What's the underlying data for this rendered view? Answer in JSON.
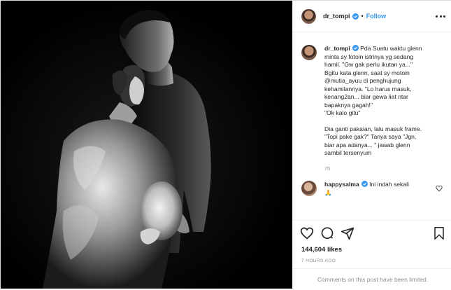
{
  "post": {
    "author": "dr_tompi",
    "follow_label": "Follow",
    "separator": "•",
    "photo_alt": "Black-and-white portrait of a pregnant woman in a tulle gown and a man in a turtleneck, both facing right",
    "caption_lines": [
      "Pda Suatu waktu glenn",
      "minta sy fotoin istrinya yg sedang",
      "hamil. \"Gw gak perlu ikutan ya...\"",
      "Bgitu kata glenn, saat sy motoin",
      "@mutia_ayuu di penghujung",
      "kehamilannya. \"Lo harus masuk,",
      "kenang2an... biar gewa liat ntar",
      "bapaknya gagah!\"",
      "\"Ok kalo gitu\""
    ],
    "caption_lines_2": [
      "Dia ganti pakaian, lalu masuk frame.",
      "\"Topi pake gak?\" Tanya saya \"Jgn,",
      "biar apa adanya... \" jawab glenn",
      "sambil tersenyum"
    ],
    "caption_time": "7h",
    "comment": {
      "author": "happysalma",
      "text": "Ini indah sekali",
      "emoji": "🙏"
    },
    "likes": "144,604 likes",
    "posted_ago": "7 HOURS AGO",
    "comments_limited": "Comments on this post have been limited."
  },
  "icons": {
    "verified": "verified-badge-icon",
    "more": "more-options-icon",
    "like": "heart-icon",
    "comment": "comment-bubble-icon",
    "share": "paper-plane-icon",
    "save": "bookmark-icon",
    "comment_like": "small-heart-icon"
  },
  "colors": {
    "accent": "#3897f0",
    "text": "#262626",
    "muted": "#8e8e8e",
    "border": "#efefef"
  }
}
